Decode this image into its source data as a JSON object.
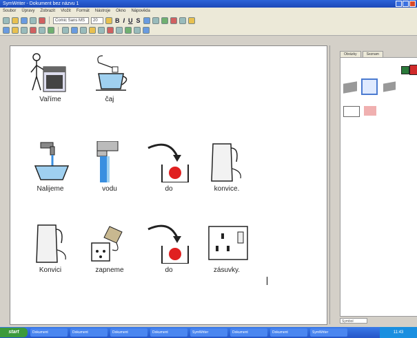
{
  "window": {
    "title": "SymWriter - Dokument bez názvu 1"
  },
  "menu": [
    "Soubor",
    "Úpravy",
    "Zobrazit",
    "Vložit",
    "Formát",
    "Nástroje",
    "Okno",
    "Nápověda"
  ],
  "toolbar": {
    "font_name": "Comic Sans MS",
    "font_size": "20",
    "bold": "B",
    "italic": "I",
    "underline": "U",
    "strike": "S"
  },
  "document": {
    "rows": [
      [
        "Vaříme",
        "čaj"
      ],
      [
        "Nalijeme",
        "vodu",
        "do",
        "konvice."
      ],
      [
        "Konvici",
        "zapneme",
        "do",
        "zásuvky."
      ]
    ]
  },
  "sidepanel": {
    "tabs": [
      "Obrázky",
      "Seznam"
    ],
    "status": "Symbol"
  },
  "taskbar": {
    "start": "start",
    "tasks": [
      "Dokument",
      "Dokument",
      "Dokument",
      "Dokument",
      "SymWriter",
      "Dokument",
      "Dokument",
      "SymWriter"
    ],
    "clock": "11:43"
  }
}
